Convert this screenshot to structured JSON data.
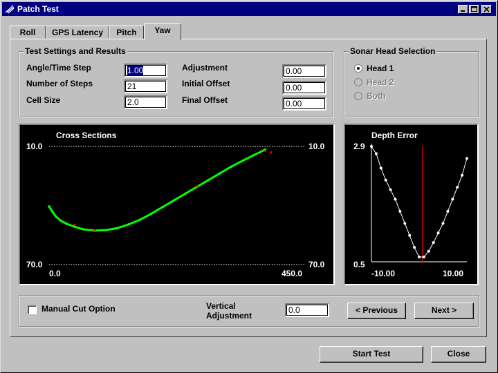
{
  "window": {
    "title": "Patch Test"
  },
  "tabs": [
    {
      "label": "Roll"
    },
    {
      "label": "GPS Latency"
    },
    {
      "label": "Pitch"
    },
    {
      "label": "Yaw",
      "active": true
    }
  ],
  "test_settings": {
    "title": "Test Settings and Results",
    "angle_time_step": {
      "label": "Angle/Time Step",
      "value": "1.00"
    },
    "number_of_steps": {
      "label": "Number of Steps",
      "value": "21"
    },
    "cell_size": {
      "label": "Cell Size",
      "value": "2.0"
    },
    "adjustment": {
      "label": "Adjustment",
      "value": "0.00"
    },
    "initial_offset": {
      "label": "Initial Offset",
      "value": "0.00"
    },
    "final_offset": {
      "label": "Final Offset",
      "value": "0.00"
    }
  },
  "sonar_head": {
    "title": "Sonar Head Selection",
    "options": [
      {
        "label": "Head 1",
        "selected": true,
        "enabled": true
      },
      {
        "label": "Head 2",
        "selected": false,
        "enabled": false
      },
      {
        "label": "Both",
        "selected": false,
        "enabled": false
      }
    ]
  },
  "cross_sections": {
    "title": "Cross Sections",
    "top_left": "10.0",
    "top_right": "10.0",
    "bottom_left": "70.0",
    "bottom_right": "70.0",
    "x_min_label": "0.0",
    "x_max_label": "450.0"
  },
  "chart_data": [
    {
      "type": "scatter",
      "title": "Cross Sections",
      "xlim": [
        0,
        450
      ],
      "ylim": [
        70,
        10
      ],
      "grid": false,
      "series": [
        {
          "color": "#00ff00",
          "x": [
            0,
            6,
            12,
            20,
            30,
            45,
            60,
            80,
            100,
            120,
            140,
            160,
            180,
            200,
            220,
            240,
            260,
            280,
            300,
            320,
            340,
            360,
            380
          ],
          "y": [
            40.5,
            43.2,
            45.6,
            47.6,
            49.2,
            50.8,
            52.1,
            52.7,
            52.5,
            51.5,
            49.6,
            47.2,
            44.1,
            40.7,
            37.3,
            33.9,
            30.5,
            27.1,
            23.7,
            20.3,
            17.3,
            14.4,
            11.6
          ]
        },
        {
          "color": "#ff0000",
          "x": [
            45,
            80,
            260,
            380,
            390
          ],
          "y": [
            49.8,
            52.4,
            30.2,
            12.3,
            13.0
          ]
        }
      ]
    },
    {
      "type": "line",
      "title": "Depth Error",
      "xlim": [
        -10.0,
        10.0
      ],
      "ylim": [
        0.5,
        2.9
      ],
      "x": [
        -10,
        -9,
        -8,
        -7,
        -6,
        -5,
        -4,
        -3,
        -2,
        -1,
        0,
        1,
        2,
        3,
        4,
        5,
        6,
        7,
        8,
        9,
        10
      ],
      "values": [
        2.9,
        2.75,
        2.45,
        2.2,
        2.0,
        1.8,
        1.55,
        1.3,
        1.05,
        0.8,
        0.6,
        0.6,
        0.72,
        0.9,
        1.1,
        1.3,
        1.55,
        1.8,
        2.05,
        2.3,
        2.65
      ],
      "marker_x": 0.7
    }
  ],
  "depth_error": {
    "title": "Depth Error",
    "y_max_label": "2.9",
    "y_min_label": "0.5",
    "x_min_label": "-10.00",
    "x_max_label": "10.00"
  },
  "options_bar": {
    "manual_cut_label": "Manual Cut Option",
    "vertical_adjustment_label_1": "Vertical",
    "vertical_adjustment_label_2": "Adjustment",
    "vertical_adjustment_value": "0.0",
    "previous_label": "< Previous",
    "next_label": "Next >"
  },
  "footer": {
    "start_test_label": "Start Test",
    "close_label": "Close"
  },
  "colors": {
    "title_bar": "#000080",
    "face": "#c0c0c0",
    "cross_section_green": "#00ff00",
    "cross_section_red": "#ff0000",
    "depth_marker": "#cc0000"
  }
}
